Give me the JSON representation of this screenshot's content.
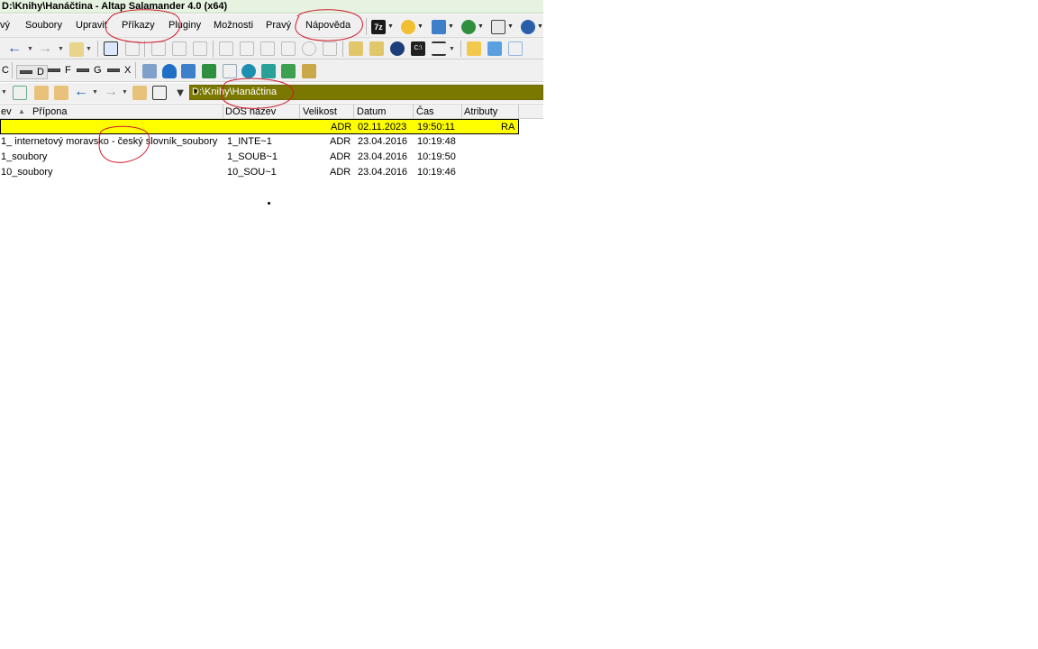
{
  "window": {
    "title": "D:\\Knihy\\Hanáčtina - Altap Salamander 4.0 (x64)"
  },
  "menu": {
    "items": [
      "vý",
      "Soubory",
      "Upravit",
      "Příkazy",
      "Pluginy",
      "Možnosti",
      "Pravý",
      "Nápověda"
    ]
  },
  "drives": [
    "C",
    "D",
    "F",
    "G",
    "X"
  ],
  "path": {
    "value": "D:\\Knihy\\Hanáčtina"
  },
  "columns": {
    "name": "ev",
    "ext": "Přípona",
    "dosname": "DOS název",
    "size": "Velikost",
    "date": "Datum",
    "time": "Čas",
    "attrs": "Atributy"
  },
  "rows": [
    {
      "name": "",
      "dosname": "",
      "size": "ADR",
      "date": "02.11.2023",
      "time": "19:50:11",
      "attrs": "RA"
    },
    {
      "name": "1_ internetový moravsko - český slovník_soubory",
      "dosname": "1_INTE~1",
      "size": "ADR",
      "date": "23.04.2016",
      "time": "10:19:48",
      "attrs": ""
    },
    {
      "name": "1_soubory",
      "dosname": "1_SOUB~1",
      "size": "ADR",
      "date": "23.04.2016",
      "time": "10:19:50",
      "attrs": ""
    },
    {
      "name": "10_soubory",
      "dosname": "10_SOU~1",
      "size": "ADR",
      "date": "23.04.2016",
      "time": "10:19:46",
      "attrs": ""
    }
  ],
  "colors": {
    "selection": "#ffff00",
    "pathbar": "#7a7800",
    "annotation": "#d0192b"
  },
  "icons": {
    "toolbar": [
      "back-arrow-icon",
      "forward-arrow-icon",
      "filter-icon",
      "cut-icon",
      "copy-icon",
      "paste-icon",
      "pack-icon",
      "unpack-icon",
      "find-icon",
      "command-prompt-icon",
      "view-mode-icon",
      "folder-icon",
      "refresh-icon"
    ],
    "plugins": [
      "7zip-icon",
      "ftp-icon",
      "network-icon",
      "globe-icon"
    ]
  }
}
